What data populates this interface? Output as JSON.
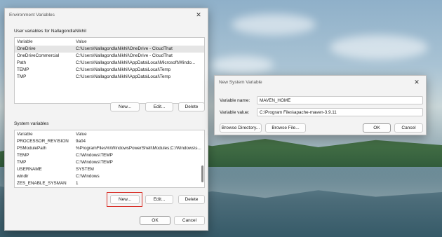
{
  "env_window": {
    "title": "Environment Variables",
    "user_section_label": "User variables for NallagondlaNikhil",
    "user_columns": [
      "Variable",
      "Value"
    ],
    "user_rows": [
      {
        "variable": "OneDrive",
        "value": "C:\\Users\\NallagondlaNikhil\\OneDrive - CloudThat",
        "selected": true
      },
      {
        "variable": "OneDriveCommercial",
        "value": "C:\\Users\\NallagondlaNikhil\\OneDrive - CloudThat",
        "selected": false
      },
      {
        "variable": "Path",
        "value": "C:\\Users\\NallagondlaNikhil\\AppData\\Local\\Microsoft\\Windo...",
        "selected": false
      },
      {
        "variable": "TEMP",
        "value": "C:\\Users\\NallagondlaNikhil\\AppData\\Local\\Temp",
        "selected": false
      },
      {
        "variable": "TMP",
        "value": "C:\\Users\\NallagondlaNikhil\\AppData\\Local\\Temp",
        "selected": false
      }
    ],
    "user_buttons": {
      "new": "New...",
      "edit": "Edit...",
      "delete": "Delete"
    },
    "system_section_label": "System variables",
    "system_columns": [
      "Variable",
      "Value"
    ],
    "system_rows": [
      {
        "variable": "PROCESSOR_REVISION",
        "value": "9a04"
      },
      {
        "variable": "PSModulePath",
        "value": "%ProgramFiles%\\WindowsPowerShell\\Modules;C:\\Windows\\s..."
      },
      {
        "variable": "TEMP",
        "value": "C:\\Windows\\TEMP"
      },
      {
        "variable": "TMP",
        "value": "C:\\Windows\\TEMP"
      },
      {
        "variable": "USERNAME",
        "value": "SYSTEM"
      },
      {
        "variable": "windir",
        "value": "C:\\Windows"
      },
      {
        "variable": "ZES_ENABLE_SYSMAN",
        "value": "1"
      }
    ],
    "system_buttons": {
      "new": "New...",
      "edit": "Edit...",
      "delete": "Delete"
    },
    "ok": "OK",
    "cancel": "Cancel",
    "close_glyph": "✕"
  },
  "new_var_dialog": {
    "title": "New System Variable",
    "name_label": "Variable name:",
    "name_value": "MAVEN_HOME",
    "value_label": "Variable value:",
    "value_value": "C:\\Program Files\\apache-maven-3.9.11",
    "browse_directory": "Browse Directory...",
    "browse_file": "Browse File...",
    "ok": "OK",
    "cancel": "Cancel",
    "close_glyph": "✕"
  },
  "colors": {
    "highlight": "#d9322b",
    "selected_row": "#e5e5e5"
  }
}
